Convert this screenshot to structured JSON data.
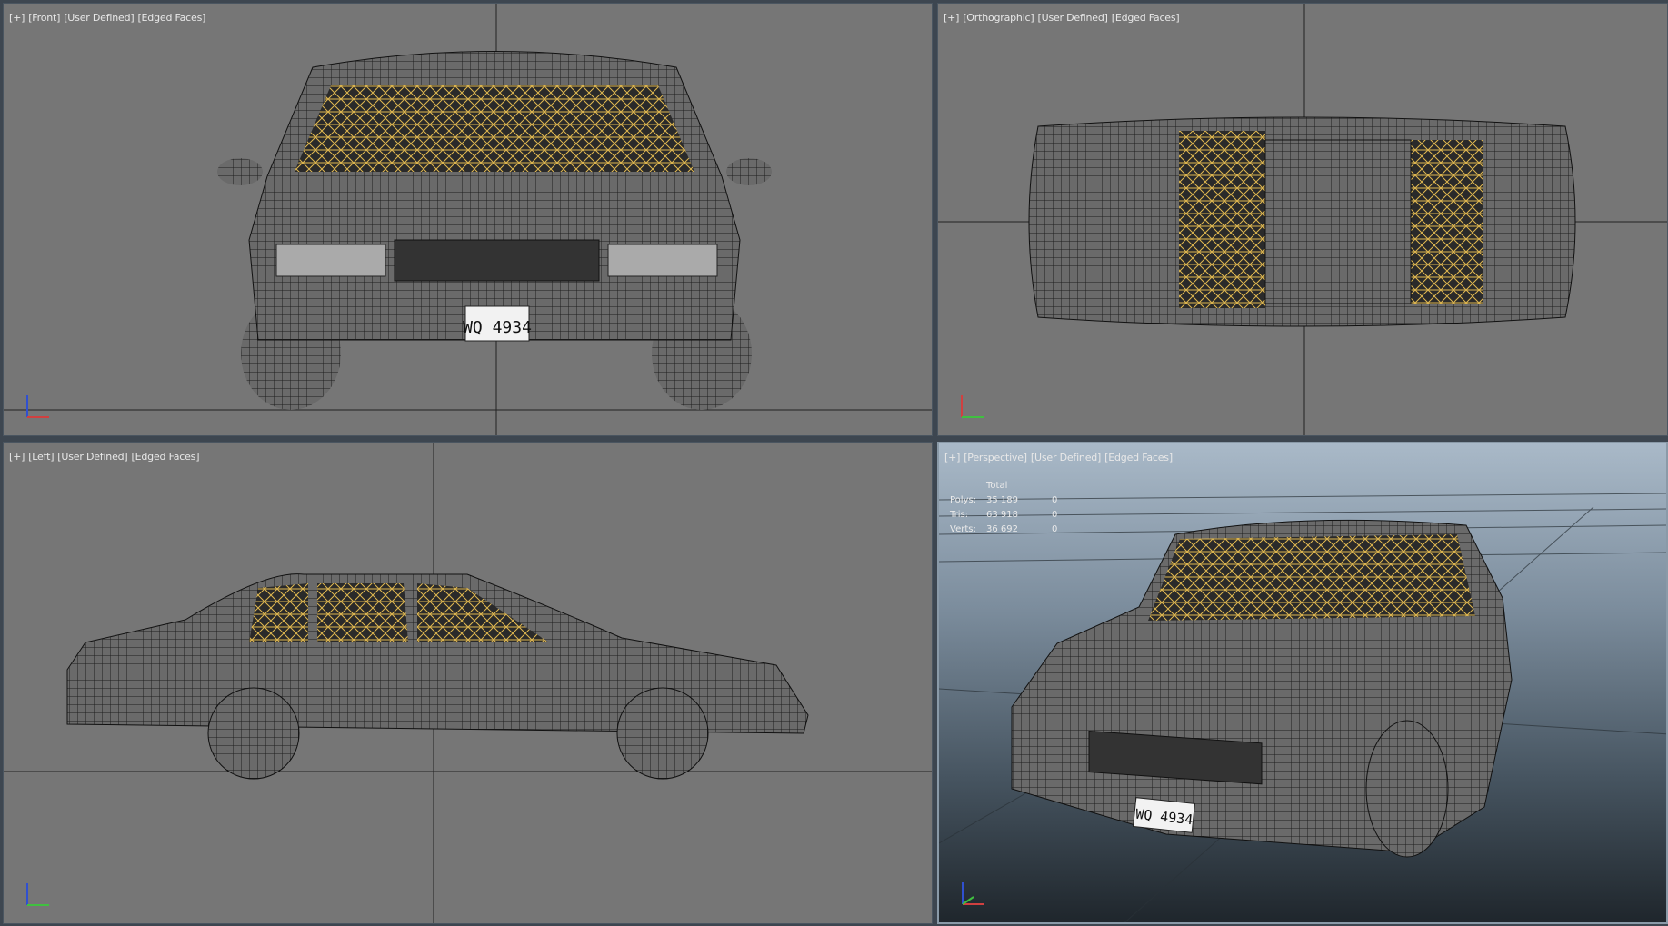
{
  "viewports": {
    "front": {
      "plus": "[+]",
      "view": "[Front]",
      "shading": "[User Defined]",
      "edges": "[Edged Faces]"
    },
    "top": {
      "plus": "[+]",
      "view": "[Orthographic]",
      "shading": "[User Defined]",
      "edges": "[Edged Faces]"
    },
    "left": {
      "plus": "[+]",
      "view": "[Left]",
      "shading": "[User Defined]",
      "edges": "[Edged Faces]"
    },
    "perspective": {
      "plus": "[+]",
      "view": "[Perspective]",
      "shading": "[User Defined]",
      "edges": "[Edged Faces]"
    }
  },
  "stats": {
    "header": "Total",
    "rows": [
      {
        "label": "Polys:",
        "total": "35 189",
        "selected": "0"
      },
      {
        "label": "Tris:",
        "total": "63 918",
        "selected": "0"
      },
      {
        "label": "Verts:",
        "total": "36 692",
        "selected": "0"
      }
    ]
  },
  "license_plate": "WQ 4934",
  "colors": {
    "viewport_bg": "#767676",
    "wire": "#1a1a1a",
    "interior_wire": "#e8c25a"
  }
}
